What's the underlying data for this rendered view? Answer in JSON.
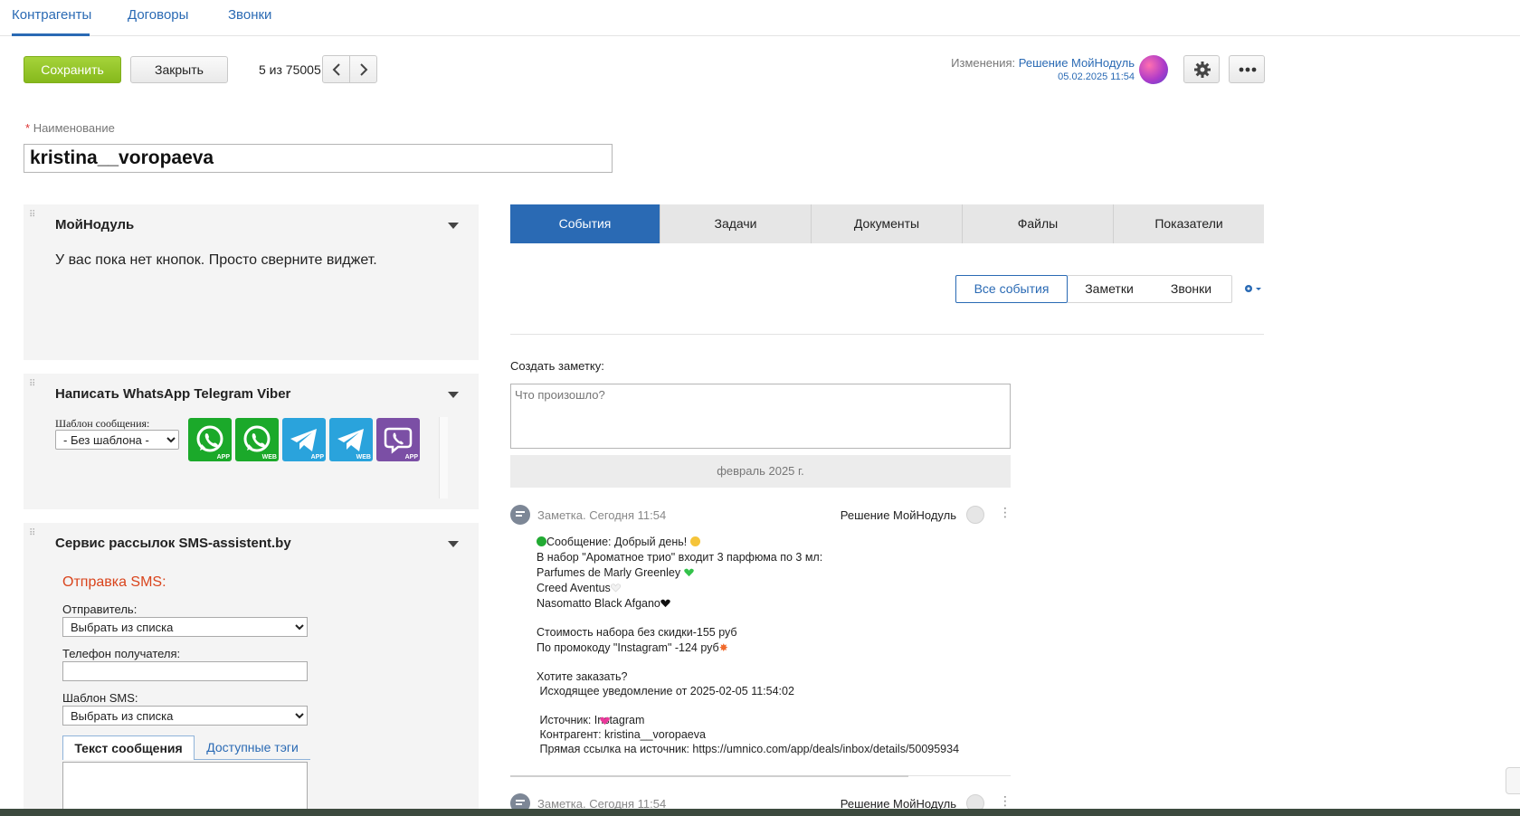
{
  "top_tabs": [
    "Контрагенты",
    "Договоры",
    "Звонки"
  ],
  "toolbar": {
    "save_label": "Сохранить",
    "close_label": "Закрыть",
    "pager": "5 из 75005",
    "changes_label": "Изменения:",
    "changes_author": "Решение МойНодуль",
    "changes_date": "05.02.2025 11:54"
  },
  "name_field": {
    "label": "Наименование",
    "value": "kristina__voropaeva"
  },
  "widgets": {
    "moinodul": {
      "title": "МойНодуль",
      "text": "У вас пока нет кнопок. Просто сверните виджет."
    },
    "messengers": {
      "title": "Написать WhatsApp Telegram Viber",
      "template_label": "Шаблон сообщения:",
      "template_value": "- Без шаблона -",
      "buttons": [
        {
          "name": "whatsapp-app",
          "sub": "APP",
          "color": "#1ba92a"
        },
        {
          "name": "whatsapp-web",
          "sub": "WEB",
          "color": "#1ba92a"
        },
        {
          "name": "telegram-app",
          "sub": "APP",
          "color": "#2aa3dc"
        },
        {
          "name": "telegram-web",
          "sub": "WEB",
          "color": "#2aa3dc"
        },
        {
          "name": "viber-app",
          "sub": "APP",
          "color": "#7b4fa5"
        }
      ]
    },
    "sms": {
      "title": "Сервис рассылок SMS-assistent.by",
      "heading": "Отправка SMS:",
      "sender_label": "Отправитель:",
      "sender_value": "Выбрать из списка",
      "phone_label": "Телефон получателя:",
      "template_label": "Шаблон SMS:",
      "template_value": "Выбрать из списка",
      "tab_text": "Текст сообщения",
      "tab_tags": "Доступные тэги"
    }
  },
  "right_tabs": [
    "События",
    "Задачи",
    "Документы",
    "Файлы",
    "Показатели"
  ],
  "filters": [
    "Все события",
    "Заметки",
    "Звонки"
  ],
  "note": {
    "label": "Создать заметку:",
    "placeholder": "Что произошло?"
  },
  "date_separator": "февраль 2025 г.",
  "events": [
    {
      "meta": "Заметка. Сегодня 11:54",
      "author": "Решение МойНодуль",
      "lines": [
        "Сообщение: Добрый день!",
        "В набор \"Ароматное трио\" входит 3 парфюма по 3 мл:",
        "Parfumes de Marly Greenley",
        "Creed Aventus",
        "Nasomatto Black Afgano",
        "",
        "Стоимость набора без скидки-155 руб",
        "По промокоду \"Instagram\" -124 руб",
        "",
        "Хотите заказать?",
        " Исходящее уведомление от 2025-02-05 11:54:02",
        "",
        " Источник: Instagram",
        " Контрагент: kristina__voropaeva",
        " Прямая ссылка на источник: https://umnico.com/app/deals/inbox/details/50095934"
      ]
    },
    {
      "meta": "Заметка. Сегодня 11:54",
      "author": "Решение МойНодуль"
    }
  ],
  "colors": {
    "accent": "#2a6ab4",
    "save": "#94c524",
    "sms_heading": "#d9441c"
  }
}
